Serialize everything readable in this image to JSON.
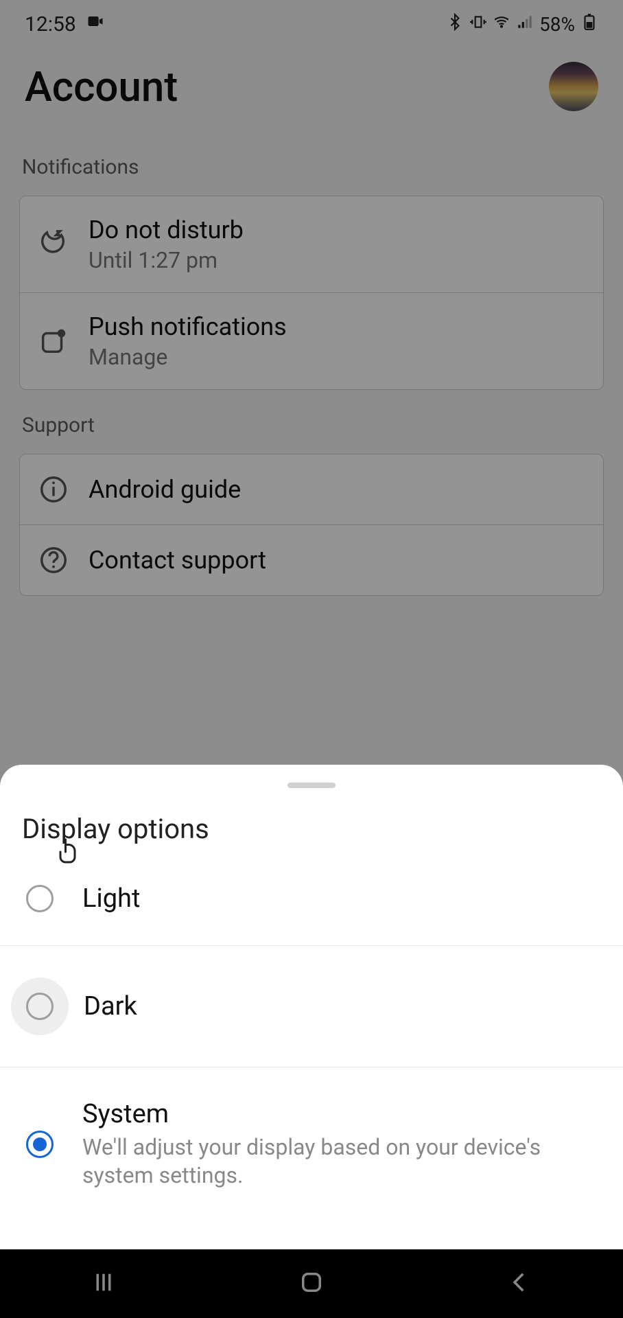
{
  "status": {
    "time": "12:58",
    "battery": "58%"
  },
  "header": {
    "title": "Account"
  },
  "sections": {
    "notifications": {
      "label": "Notifications",
      "dnd": {
        "title": "Do not disturb",
        "subtitle": "Until 1:27 pm"
      },
      "push": {
        "title": "Push notifications",
        "subtitle": "Manage"
      }
    },
    "support": {
      "label": "Support",
      "guide": {
        "title": "Android guide"
      },
      "contact": {
        "title": "Contact support"
      }
    }
  },
  "sheet": {
    "title": "Display options",
    "options": {
      "light": {
        "label": "Light"
      },
      "dark": {
        "label": "Dark"
      },
      "system": {
        "label": "System",
        "sub": "We'll adjust your display based on your device's system settings."
      }
    },
    "selected": "system"
  }
}
